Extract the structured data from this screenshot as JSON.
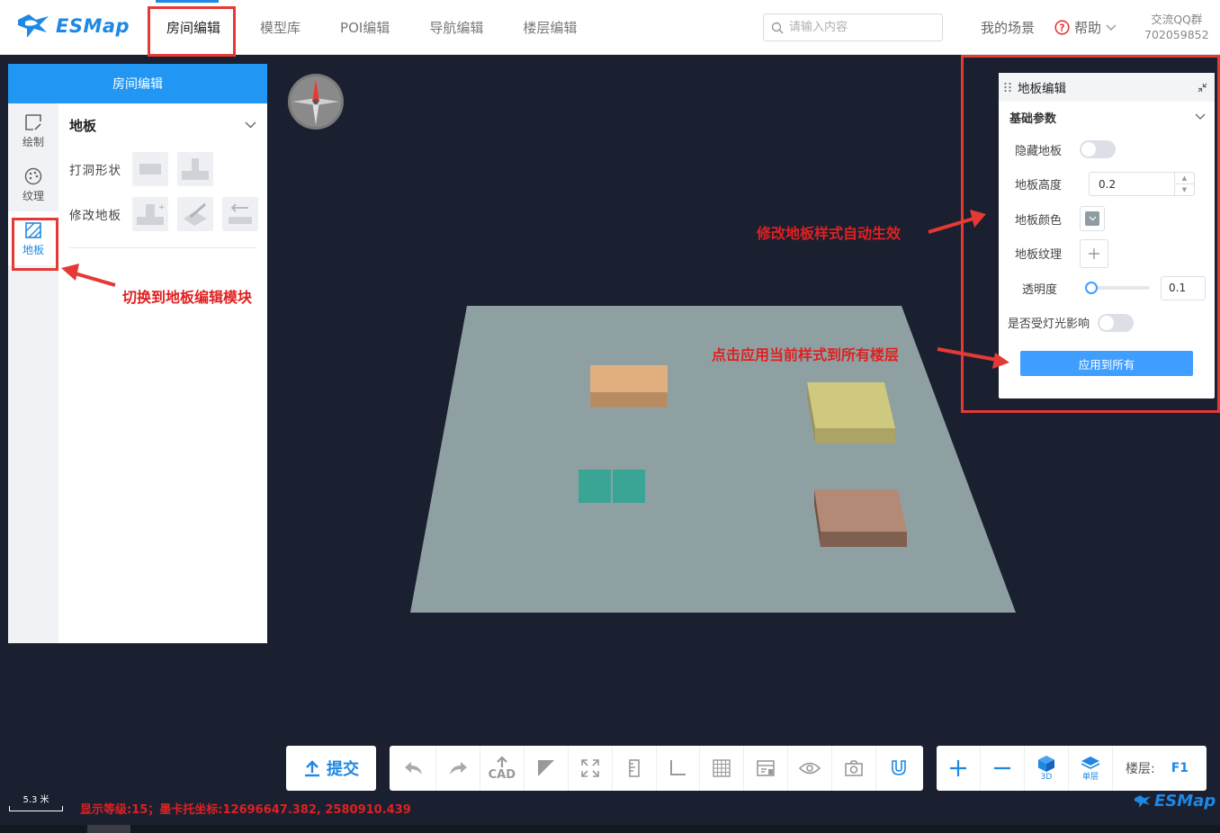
{
  "header": {
    "logo_text": "ESMap",
    "nav": [
      "房间编辑",
      "模型库",
      "POI编辑",
      "导航编辑",
      "楼层编辑"
    ],
    "search_placeholder": "请输入内容",
    "my_scene": "我的场景",
    "help": "帮助",
    "qq_group_label": "交流QQ群",
    "qq_group_number": "702059852"
  },
  "left_panel": {
    "title": "房间编辑",
    "tabs": [
      "绘制",
      "纹理",
      "地板"
    ],
    "section_title": "地板",
    "row1_label": "打洞形状",
    "row2_label": "修改地板"
  },
  "floor_panel": {
    "title": "地板编辑",
    "subtitle": "基础参数",
    "hide_floor": "隐藏地板",
    "floor_height": "地板高度",
    "floor_height_value": "0.2",
    "floor_color": "地板颜色",
    "floor_texture": "地板纹理",
    "opacity": "透明度",
    "opacity_value": "0.1",
    "light_affect": "是否受灯光影响",
    "apply_all": "应用到所有"
  },
  "annotations": {
    "switch_module": "切换到地板编辑模块",
    "auto_effect": "修改地板样式自动生效",
    "apply_all_floors": "点击应用当前样式到所有楼层"
  },
  "toolbar": {
    "submit": "提交",
    "cad_label": "CAD",
    "view_3d": "3D",
    "single_floor": "单层",
    "floor_label": "楼层:",
    "floor_value": "F1"
  },
  "status": {
    "scale": "5.3 米",
    "coords": "显示等级:15；墨卡托坐标:12696647.382, 2580910.439"
  },
  "colors": {
    "accent": "#1e88e5",
    "annotation_red": "#e53935",
    "floor_plane": "#8fa0a3",
    "block_orange": "#e2b07e",
    "block_yellow": "#cfc87f",
    "block_teal": "#3aa595",
    "block_brown": "#b38a76"
  }
}
